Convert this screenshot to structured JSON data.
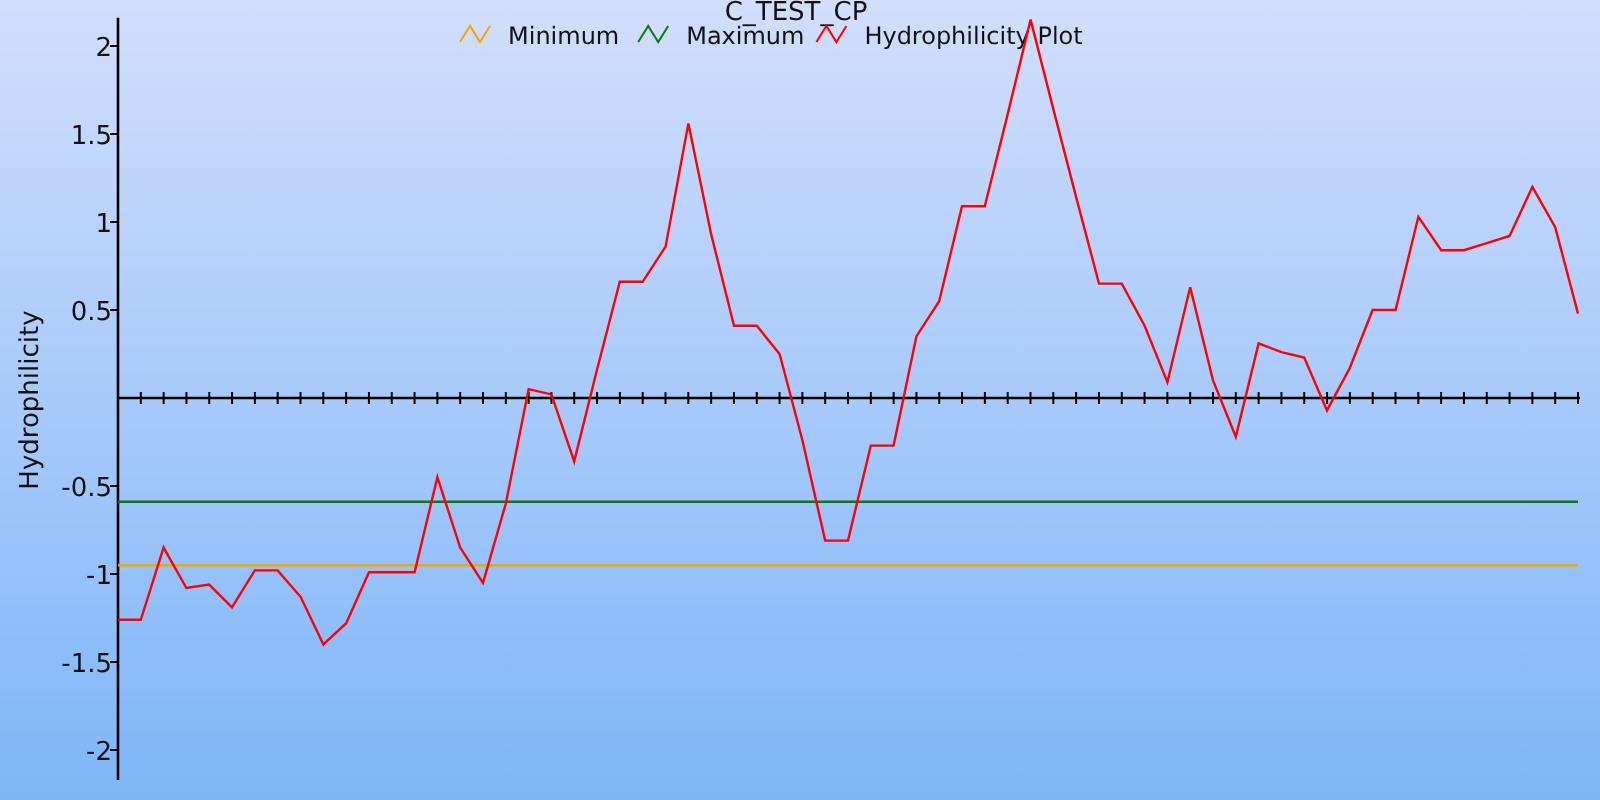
{
  "chart_data": {
    "type": "line",
    "title": "C_TEST_CP",
    "ylabel": "Hydrophilicity",
    "legend": true,
    "ylim": [
      -2.17,
      2.16
    ],
    "yticks": [
      -2,
      -1.5,
      -1,
      -0.5,
      0.5,
      1,
      1.5,
      2
    ],
    "series": [
      {
        "name": "Minimum",
        "color": "#f0a800",
        "values": [
          -0.95,
          -0.95,
          -0.95,
          -0.95,
          -0.95,
          -0.95,
          -0.95,
          -0.95,
          -0.95,
          -0.95,
          -0.95,
          -0.95,
          -0.95,
          -0.95,
          -0.95,
          -0.95,
          -0.95,
          -0.95,
          -0.95,
          -0.95,
          -0.95,
          -0.95,
          -0.95,
          -0.95,
          -0.95,
          -0.95,
          -0.95,
          -0.95,
          -0.95,
          -0.95,
          -0.95,
          -0.95,
          -0.95,
          -0.95,
          -0.95,
          -0.95,
          -0.95,
          -0.95,
          -0.95,
          -0.95,
          -0.95,
          -0.95,
          -0.95,
          -0.95,
          -0.95,
          -0.95,
          -0.95,
          -0.95,
          -0.95,
          -0.95,
          -0.95,
          -0.95,
          -0.95,
          -0.95,
          -0.95,
          -0.95,
          -0.95,
          -0.95,
          -0.95,
          -0.95,
          -0.95,
          -0.95,
          -0.95,
          -0.95,
          -0.95
        ]
      },
      {
        "name": "Maximum",
        "color": "#107810",
        "values": [
          -0.59,
          -0.59,
          -0.59,
          -0.59,
          -0.59,
          -0.59,
          -0.59,
          -0.59,
          -0.59,
          -0.59,
          -0.59,
          -0.59,
          -0.59,
          -0.59,
          -0.59,
          -0.59,
          -0.59,
          -0.59,
          -0.59,
          -0.59,
          -0.59,
          -0.59,
          -0.59,
          -0.59,
          -0.59,
          -0.59,
          -0.59,
          -0.59,
          -0.59,
          -0.59,
          -0.59,
          -0.59,
          -0.59,
          -0.59,
          -0.59,
          -0.59,
          -0.59,
          -0.59,
          -0.59,
          -0.59,
          -0.59,
          -0.59,
          -0.59,
          -0.59,
          -0.59,
          -0.59,
          -0.59,
          -0.59,
          -0.59,
          -0.59,
          -0.59,
          -0.59,
          -0.59,
          -0.59,
          -0.59,
          -0.59,
          -0.59,
          -0.59,
          -0.59,
          -0.59,
          -0.59,
          -0.59,
          -0.59,
          -0.59,
          -0.59
        ]
      },
      {
        "name": "Hydrophilicity Plot",
        "color": "#ff0000",
        "values": [
          -1.26,
          -1.26,
          -0.85,
          -1.08,
          -1.06,
          -1.19,
          -0.98,
          -0.98,
          -1.13,
          -1.4,
          -1.28,
          -0.99,
          -0.99,
          -0.99,
          -0.45,
          -0.85,
          -1.05,
          -0.6,
          0.05,
          0.02,
          -0.36,
          0.16,
          0.66,
          0.66,
          0.86,
          1.56,
          0.93,
          0.41,
          0.41,
          0.25,
          -0.24,
          -0.81,
          -0.81,
          -0.27,
          -0.27,
          0.35,
          0.55,
          1.09,
          1.09,
          1.61,
          2.15,
          1.64,
          1.14,
          0.65,
          0.65,
          0.41,
          0.09,
          0.63,
          0.1,
          -0.22,
          0.31,
          0.26,
          0.23,
          -0.07,
          0.17,
          0.5,
          0.5,
          1.03,
          0.84,
          0.84,
          0.88,
          0.92,
          1.2,
          0.97,
          0.48
        ]
      }
    ]
  }
}
